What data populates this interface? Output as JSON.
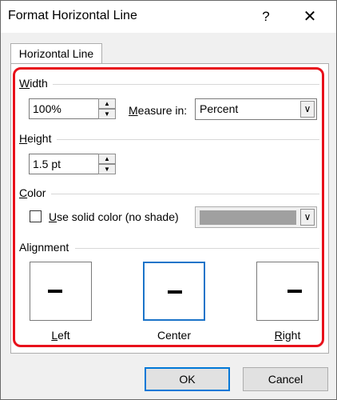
{
  "dialog": {
    "title": "Format Horizontal Line",
    "help": "?",
    "close": "✕"
  },
  "tab": {
    "label": "Horizontal Line"
  },
  "width": {
    "label_underlined": "W",
    "label_rest": "idth",
    "value": "100%",
    "measure_label_underlined": "M",
    "measure_label_rest": "easure in:",
    "measure_value": "Percent"
  },
  "height": {
    "label_underlined": "H",
    "label_rest": "eight",
    "value": "1.5 pt"
  },
  "color": {
    "label_underlined": "C",
    "label_rest": "olor",
    "checkbox_label_underlined": "U",
    "checkbox_label_rest": "se solid color (no shade)",
    "checked": false,
    "swatch_color": "#a0a0a0"
  },
  "alignment": {
    "label": "Alignment",
    "left_underlined": "L",
    "left_rest": "eft",
    "center_label": "Center",
    "right_underlined": "R",
    "right_rest": "ight",
    "selected": "center"
  },
  "buttons": {
    "ok": "OK",
    "cancel": "Cancel"
  },
  "colors": {
    "highlight": "#e8111b",
    "selected_border": "#1b74c9",
    "default_button_border": "#0078d7"
  }
}
